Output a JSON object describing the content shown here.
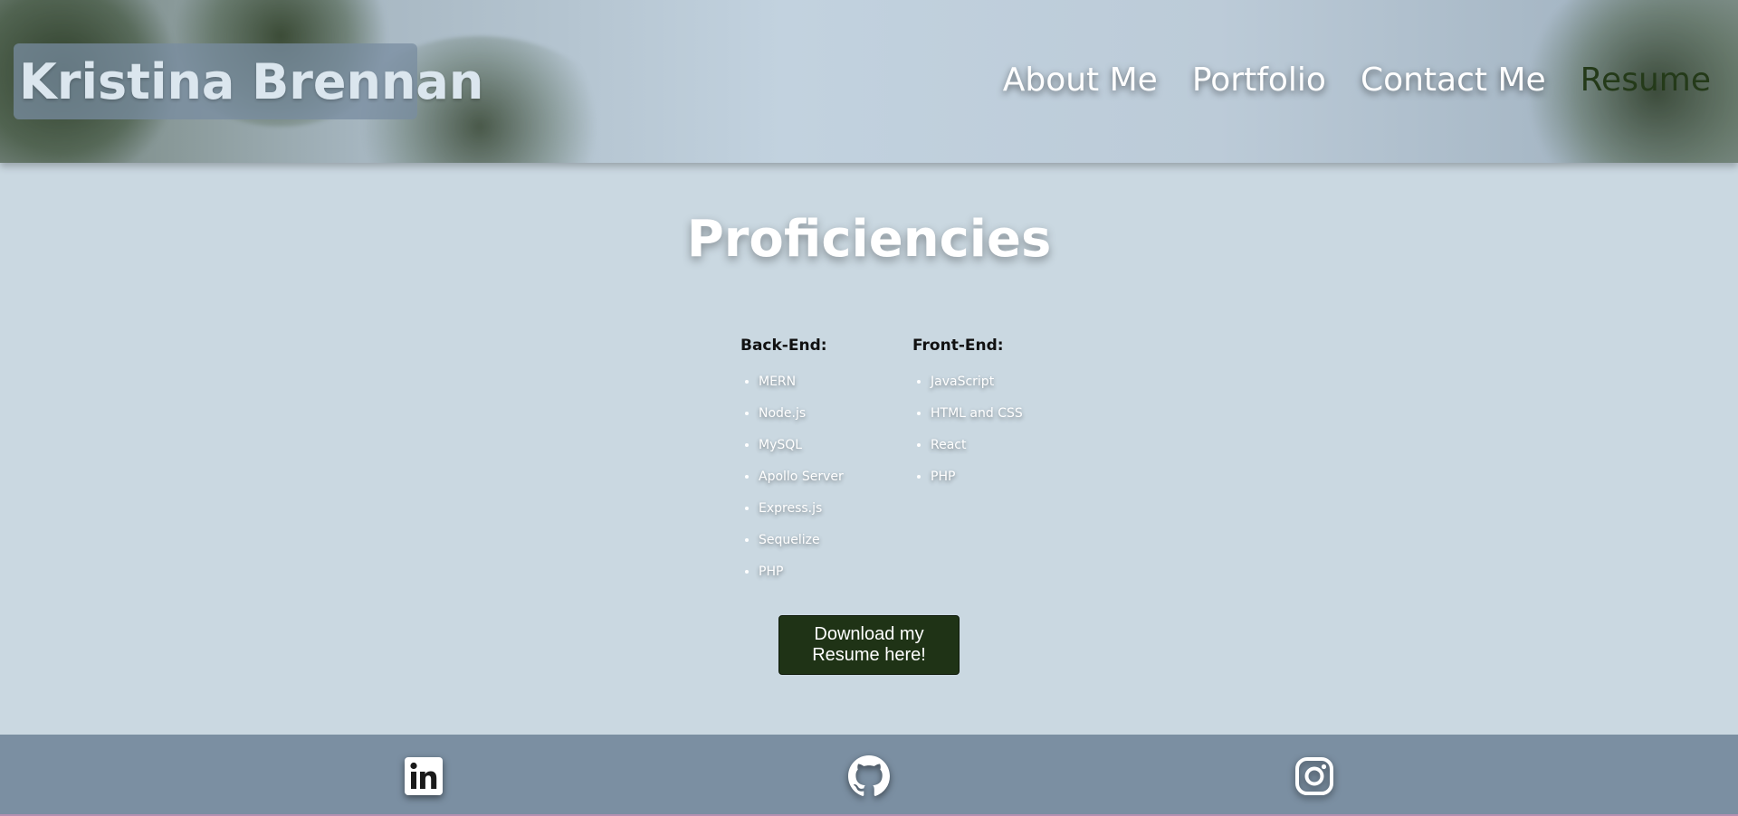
{
  "header": {
    "brand": "Kristina Brennan",
    "nav": [
      {
        "label": "About Me",
        "active": false
      },
      {
        "label": "Portfolio",
        "active": false
      },
      {
        "label": "Contact Me",
        "active": false
      },
      {
        "label": "Resume",
        "active": true
      }
    ]
  },
  "main": {
    "title": "Proficiencies",
    "backend": {
      "heading": "Back-End:",
      "items": [
        "MERN",
        "Node.js",
        "MySQL",
        "Apollo Server",
        "Express.js",
        "Sequelize",
        "PHP"
      ]
    },
    "frontend": {
      "heading": "Front-End:",
      "items": [
        "JavaScript",
        "HTML and CSS",
        "React",
        "PHP"
      ]
    },
    "download_label": "Download my Resume here!"
  },
  "footer": {
    "icons": [
      "linkedin-icon",
      "github-icon",
      "instagram-icon"
    ]
  },
  "colors": {
    "page_bg": "#cad8e1",
    "footer_bg": "#7b8fa2",
    "button_bg": "#1f3316",
    "active_nav": "#243a19"
  }
}
